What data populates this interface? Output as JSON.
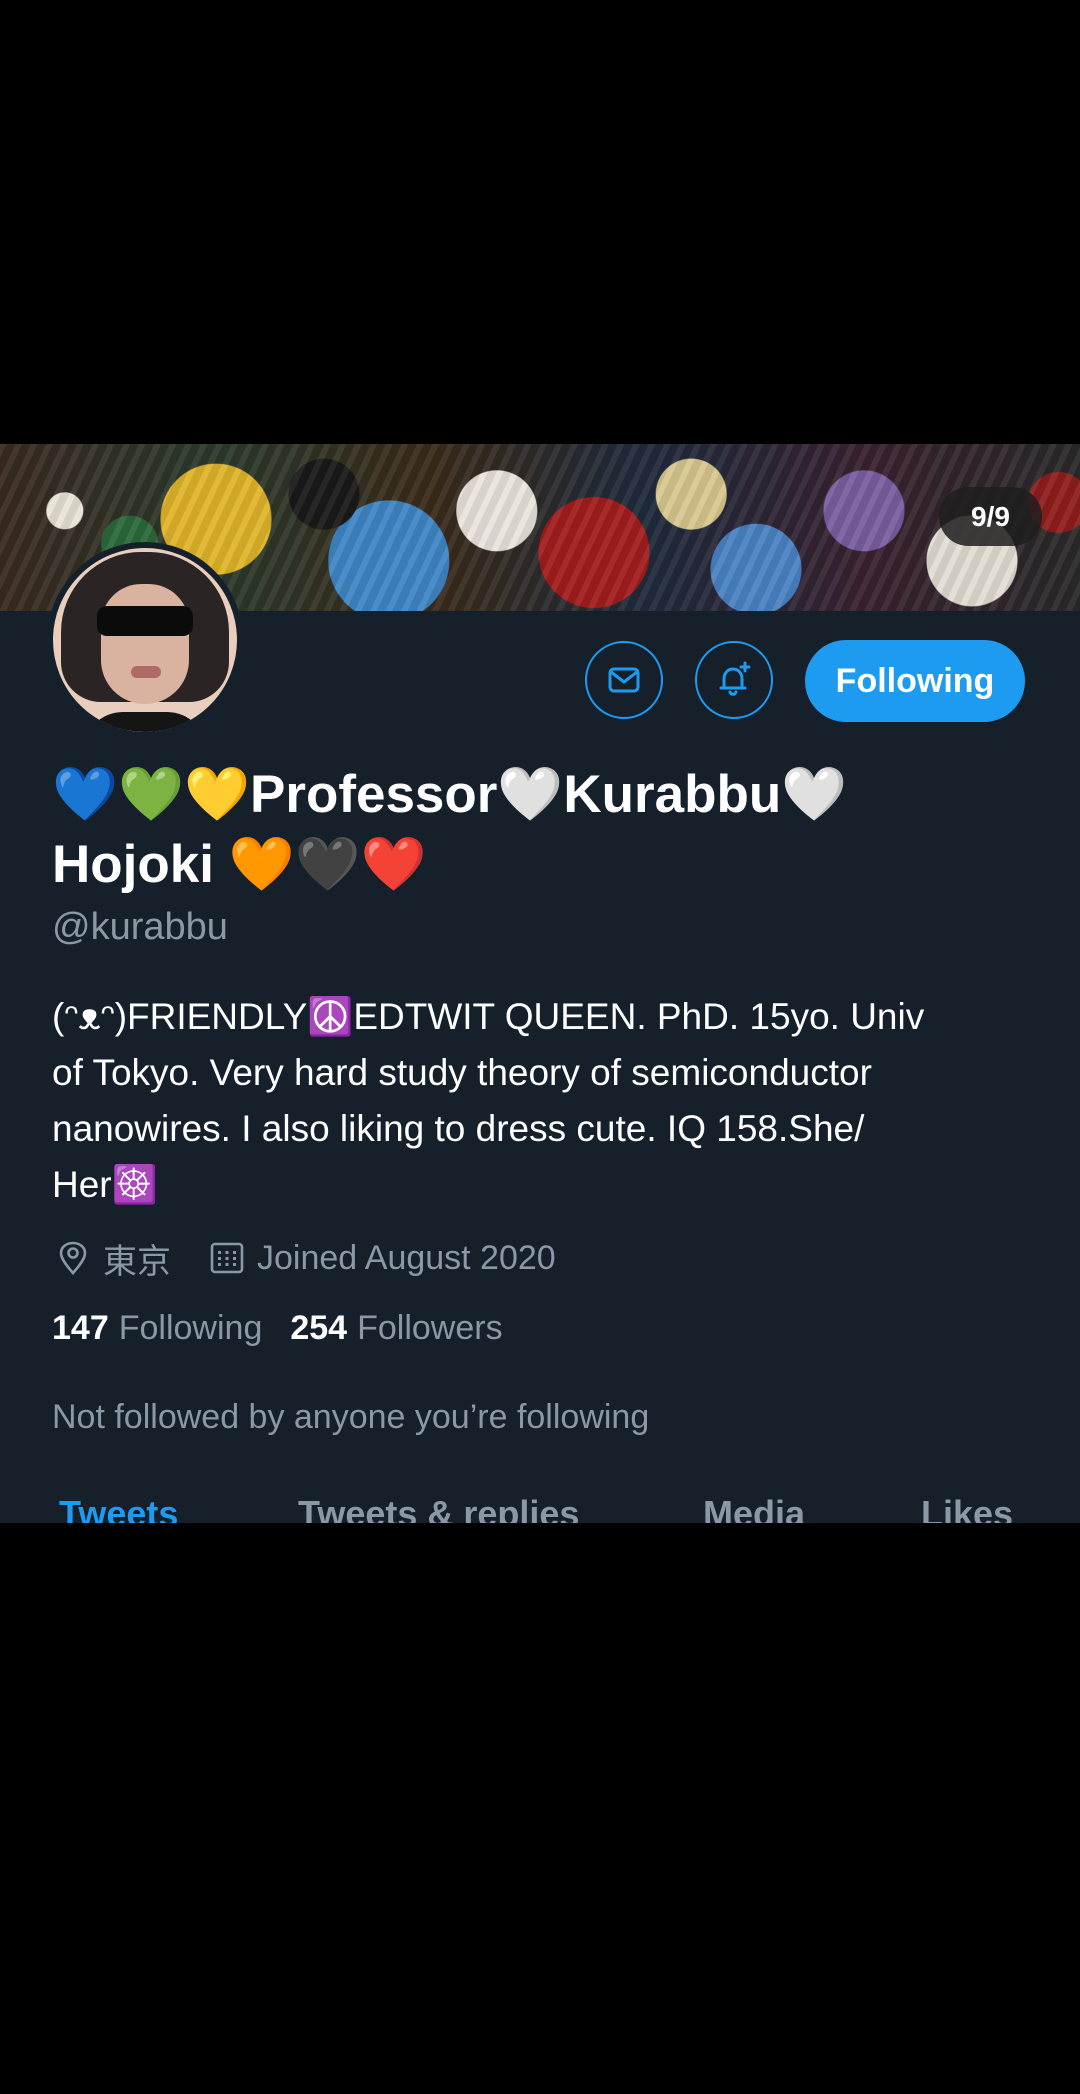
{
  "banner": {
    "counter": "9/9"
  },
  "actions": {
    "follow_label": "Following"
  },
  "profile": {
    "display_name_line1": "💙💚💛Professor🤍Kurabbu🤍",
    "display_name_line2": "Hojoki 🧡🖤❤️",
    "handle": "@kurabbu",
    "bio": "(ᵔᴥᵔ)FRIENDLY☮️EDTWIT QUEEN. PhD. 15yo. Univ\nof Tokyo. Very hard study theory of semiconductor\nnanowires. I also liking to dress cute. IQ 158.She/\nHer☸️",
    "location": "東京",
    "joined": "Joined August 2020"
  },
  "stats": {
    "following_count": "147",
    "following_label": "Following",
    "followers_count": "254",
    "followers_label": "Followers"
  },
  "social_context": "Not followed by anyone you’re following",
  "tabs": [
    {
      "label": "Tweets"
    },
    {
      "label": "Tweets & replies"
    },
    {
      "label": "Media"
    },
    {
      "label": "Likes"
    }
  ],
  "colors": {
    "background": "#15202b",
    "accent": "#1d9bf0",
    "secondary_text": "#8b98a5"
  },
  "icons": {
    "message": "envelope-icon",
    "notifications": "bell-plus-icon",
    "location": "location-pin-icon",
    "joined": "calendar-icon"
  }
}
